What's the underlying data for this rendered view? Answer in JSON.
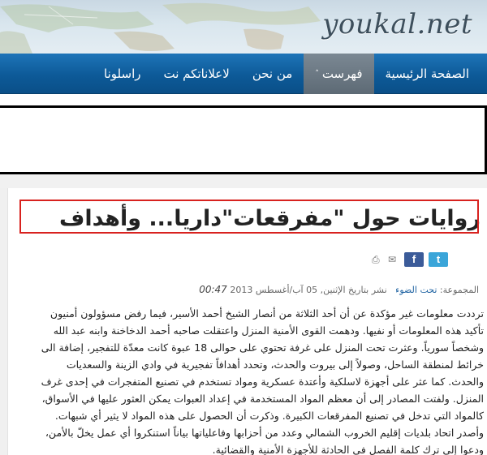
{
  "header": {
    "logo_text": "youkal.net"
  },
  "nav": {
    "items": [
      {
        "label": "الصفحة الرئيسية",
        "active": false
      },
      {
        "label": "فهرست",
        "active": true,
        "has_dropdown": true
      },
      {
        "label": "من نحن",
        "active": false
      },
      {
        "label": "لاعلاناتكم نت",
        "active": false
      },
      {
        "label": "راسلونا",
        "active": false
      }
    ]
  },
  "article": {
    "title": "روايات حول \"مفرقعات\"داريا... وأهداف",
    "share": {
      "twitter": "t",
      "facebook": "f"
    },
    "meta": {
      "category_label": "المجموعة:",
      "category": "تحت الضوء",
      "published_label": "نشر بتاريخ الإثنين, 05 آب/أغسطس 2013",
      "time": "00:47"
    },
    "body_lines": [
      "ترددت معلومات غير مؤكدة عن أن أحد الثلاثة من أنصار الشيخ أحمد الأسير، فيما رفض مسؤولون أمنيون",
      "تأكيد هذه المعلومات أو نفيها. ودهمت القوى الأمنية المنزل واعتقلت صاحبه أحمد الدخاخنة وابنه عبد الله",
      "وشخصاً سورياً. وعثرت تحت المنزل على غرفة تحتوي على حوالى 18 عبوة كانت معدّة للتفجير، إضافة الى",
      "خرائط لمنطقة الساحل، وصولاً إلى بيروت والحدث، وتحدد أهدافاً تفجيرية في وادي الزينة والسعديات",
      "والحدث. كما عثر على أجهزة لاسلكية وأعتدة عسكرية ومواد تستخدم في تصنيع المتفجرات في إحدى غرف",
      "المنزل. ولفتت المصادر إلى أن معظم المواد المستخدمة في إعداد العبوات يمكن العثور عليها في الأسواق،",
      "كالمواد التي تدخل في تصنيع المفرقعات الكبيرة. وذكرت أن الحصول على هذه المواد لا يثير أي شبهات.",
      "وأصدر اتحاد بلديات إقليم الخروب الشمالي وعدد من أحزابها وفاعلياتها بياناً استنكروا أي عمل يخلّ بالأمن،",
      "ودعوا إلى ترك كلمة الفصل في الحادثة للأجهزة الأمنية والقضائية."
    ]
  },
  "colors": {
    "nav_bg": "#0d5a98",
    "nav_active": "#5d6a75",
    "highlight_border": "#d8221f",
    "category_link": "#1f63a2",
    "twitter": "#3aa5d9",
    "facebook": "#3b5b99"
  }
}
